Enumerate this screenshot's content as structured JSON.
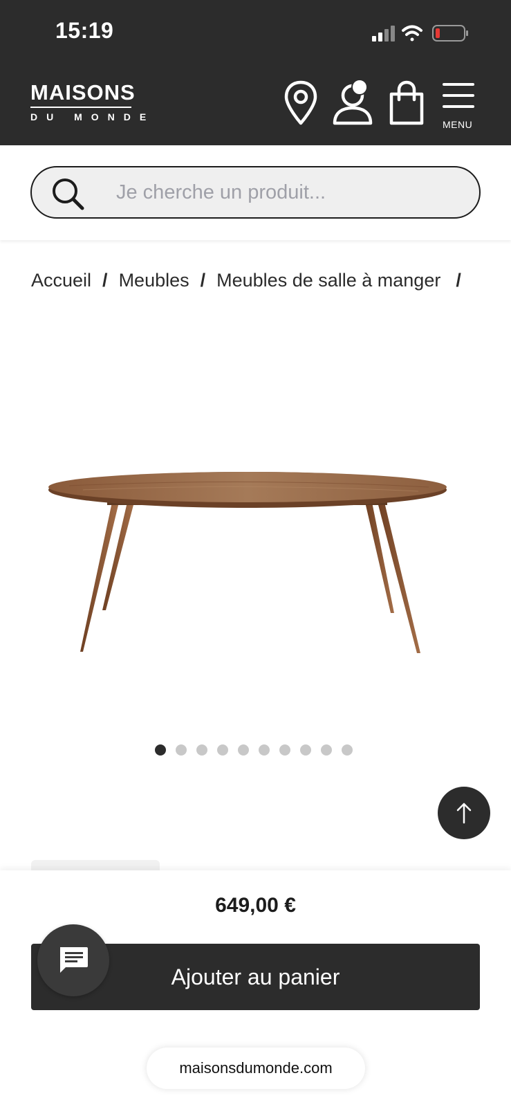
{
  "status_bar": {
    "time": "15:19"
  },
  "header": {
    "logo_main": "MAISONS",
    "logo_sub": "DU MONDE",
    "menu_label": "MENU",
    "colors": {
      "background": "#2c2c2c",
      "foreground": "#ffffff"
    },
    "icons": [
      "location-pin-icon",
      "account-icon",
      "shopping-bag-icon",
      "hamburger-menu-icon"
    ]
  },
  "search": {
    "placeholder": "Je cherche un produit..."
  },
  "breadcrumb": {
    "items": [
      "Accueil",
      "Meubles",
      "Meubles de salle à manger"
    ],
    "separator": "/"
  },
  "carousel": {
    "image_count": 10,
    "active_index": 0
  },
  "product": {
    "price": "649,00 €",
    "add_to_cart_label": "Ajouter au panier"
  },
  "browser": {
    "url": "maisonsdumonde.com"
  }
}
